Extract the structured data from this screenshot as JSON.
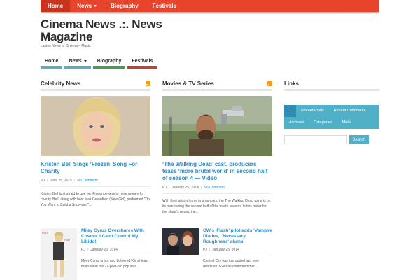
{
  "topnav": {
    "items": [
      {
        "label": "Home",
        "active": true
      },
      {
        "label": "News",
        "has_dropdown": true
      },
      {
        "label": "Biography"
      },
      {
        "label": "Festivals"
      }
    ]
  },
  "site": {
    "title": "Cinema News .:. News Magazine",
    "tagline": "Lastes News of Cinema – Music"
  },
  "mainnav": {
    "items": [
      {
        "label": "Home"
      },
      {
        "label": "News",
        "has_dropdown": true
      },
      {
        "label": "Biography"
      },
      {
        "label": "Festivals"
      }
    ]
  },
  "columns": {
    "celebrity": {
      "title": "Celebrity News",
      "featured": {
        "title": "Kristen Bell Sings ‘Frozen’ Song For Charity",
        "author": "PJ",
        "date": "June 28, 2015",
        "comments": "No Comment",
        "excerpt": "Kristen Bell isn't afraid to use her Frozenpowers to raise money for charity. Bell, along with host Max Greenfield (New Girl), performed \"Do You Want to Build a Snowman\"..."
      },
      "small": {
        "title": "Miley Cyrus Overshares With Cosmo: I Can't Control My Libido!",
        "author": "PJ",
        "date": "January 25, 2014",
        "excerpt": "Miley Cyrus is hot and bothered! Or at least that's what the 21-year-old pop star..."
      }
    },
    "movies": {
      "title": "Movies & TV Series",
      "featured": {
        "title": "‘The Walking Dead’ cast, producers tease ‘more brutal world’ in second half of season 4 — Video",
        "author": "PJ",
        "date": "January 25, 2014",
        "comments": "No Comment",
        "excerpt": "With their prison home in shambles, the The Walking Dead gang is on its own during the second half of the fourth season. In this trailer for the show's return, the..."
      },
      "small": {
        "title": "CW's 'Flash' pilot adds 'Vampire Diaries,' 'Necessary Roughness' alums",
        "author": "PJ",
        "date": "January 25, 2014",
        "excerpt": "Central City has just added two new residents. EW has confirmed that"
      }
    }
  },
  "sidebar": {
    "title": "Links",
    "tabs": [
      "1",
      "Recent Posts",
      "Recent Comments",
      "Archives",
      "Categories",
      "Meta"
    ],
    "search_button": "Search",
    "search_placeholder": ""
  },
  "colors": {
    "accent_red": "#e8432b",
    "link_blue": "#2b8cc4",
    "tab_blue": "#4fb0c8"
  }
}
